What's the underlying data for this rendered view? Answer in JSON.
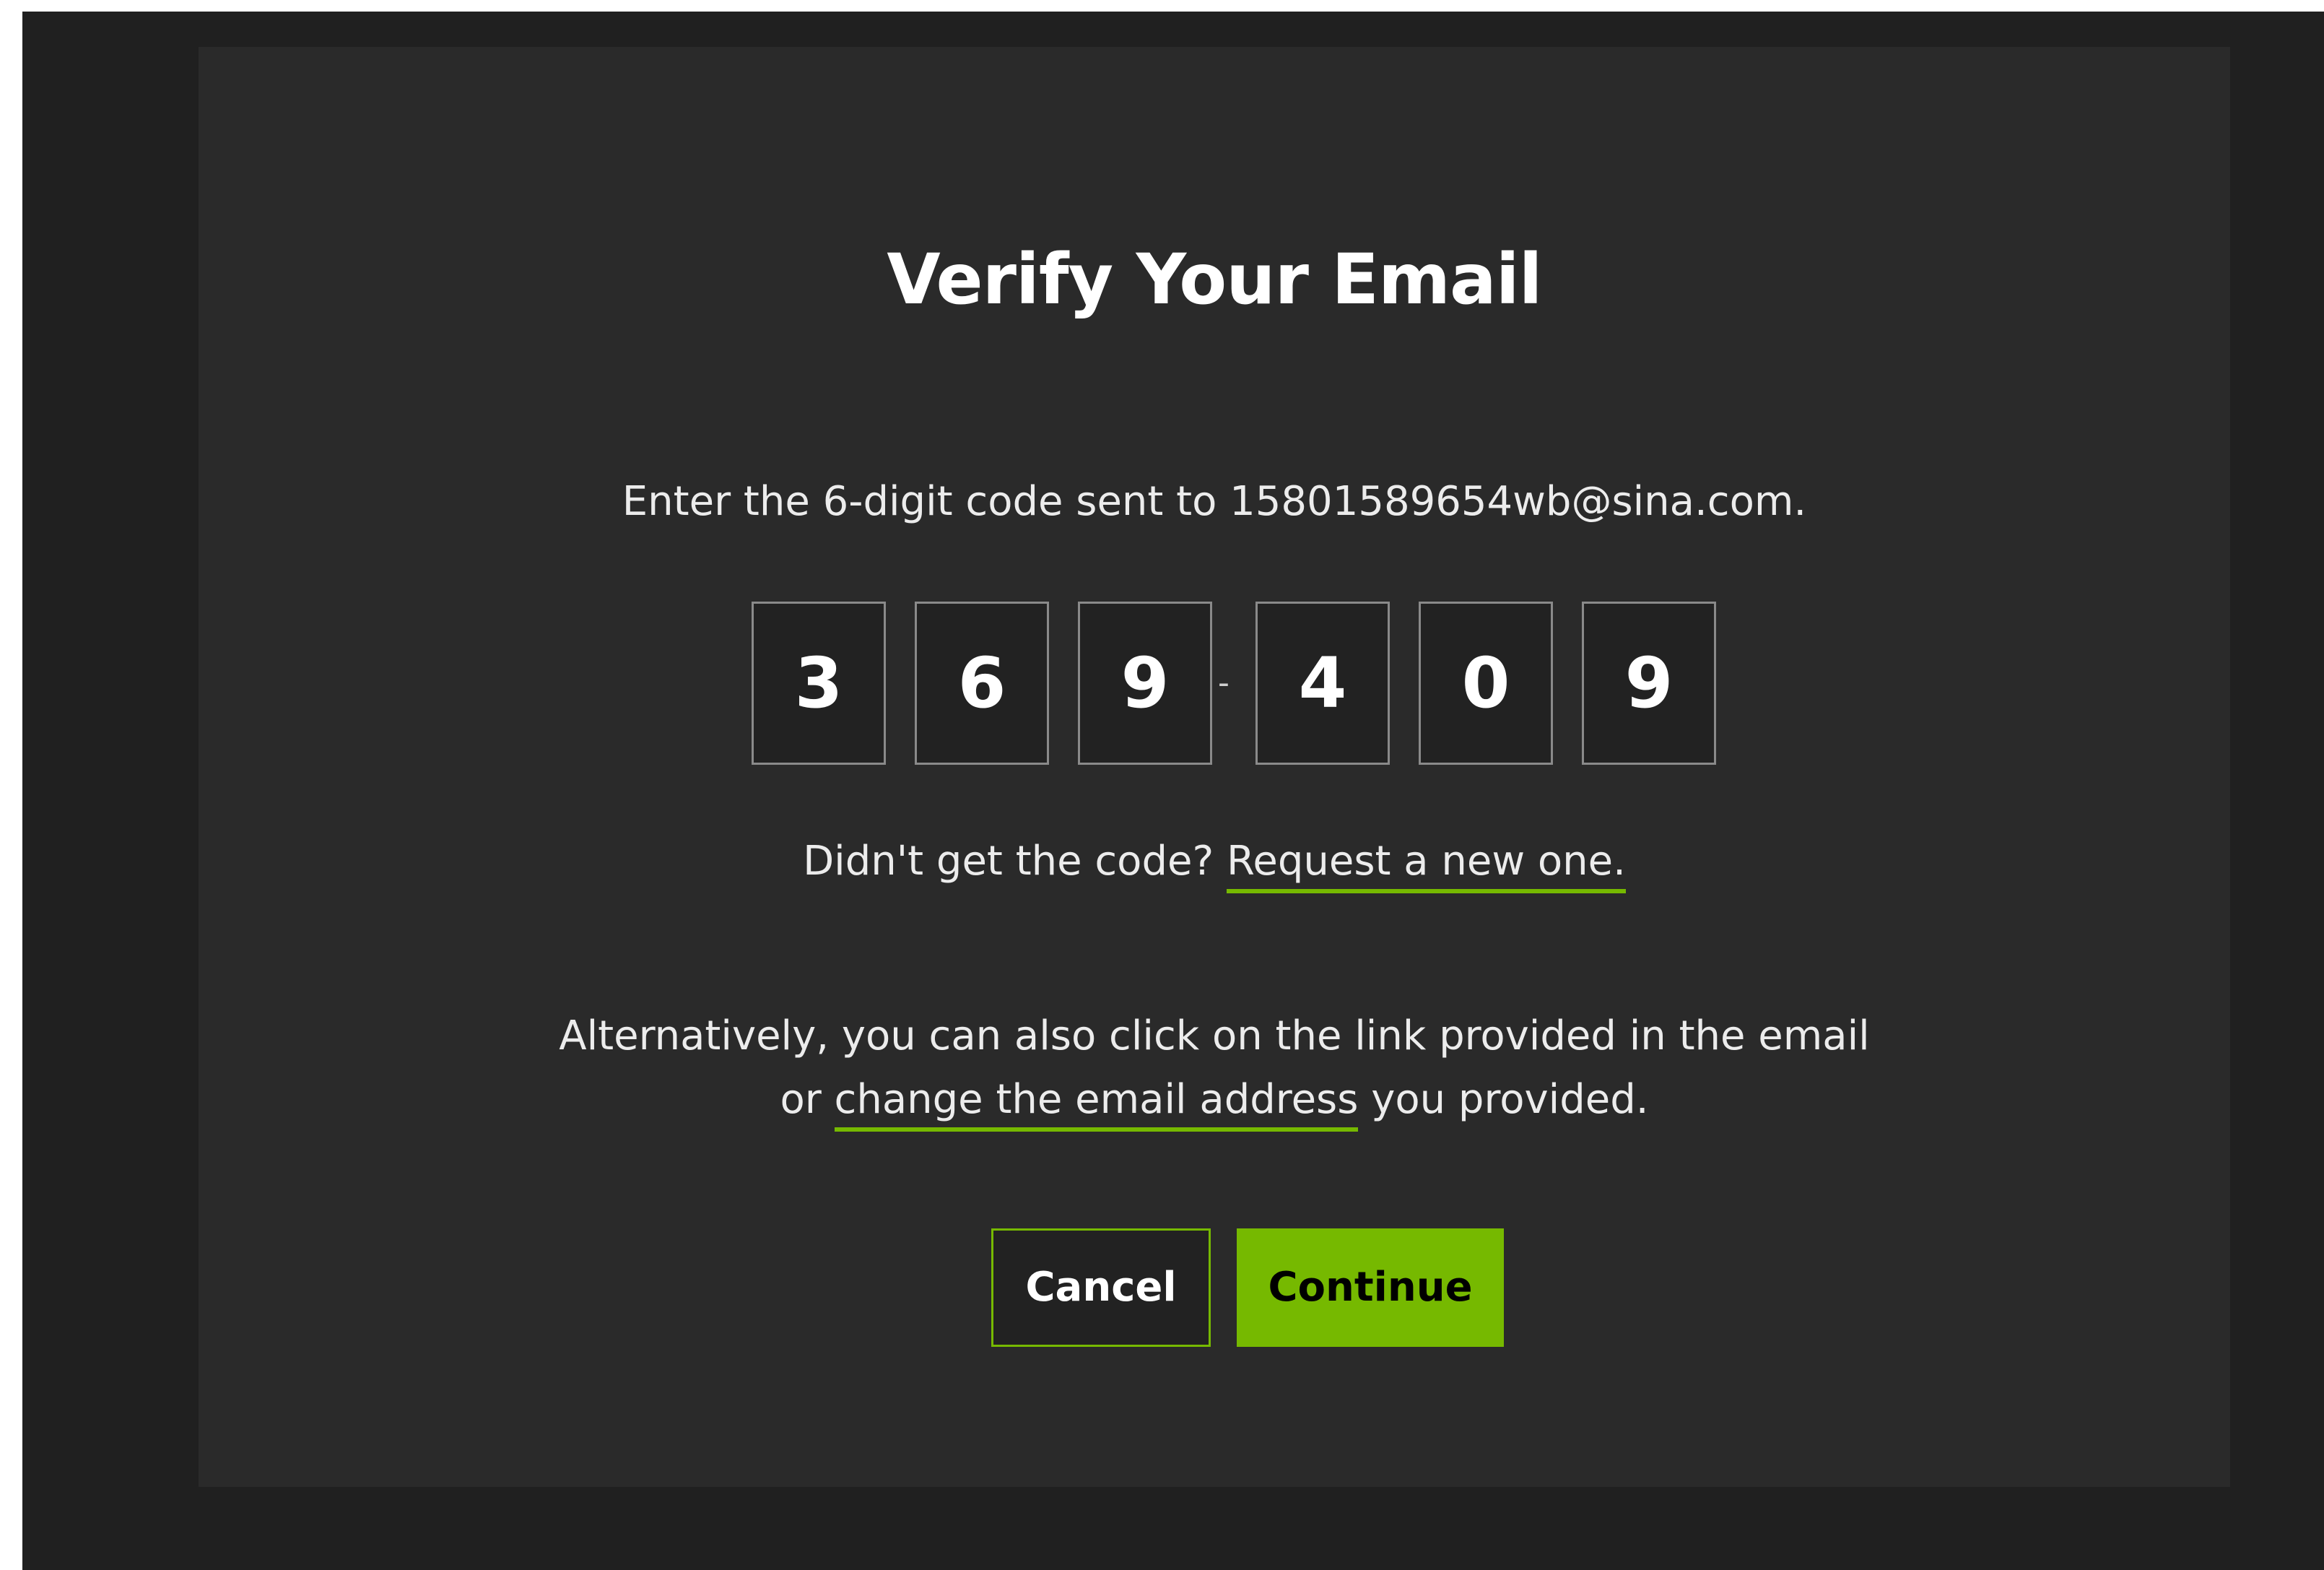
{
  "colors": {
    "accent": "#76b900",
    "background": "#202020",
    "card": "#2a2a2a",
    "text": "#ececec"
  },
  "dialog": {
    "title": "Verify Your Email",
    "instruction_prefix": "Enter the 6-digit code sent to ",
    "email": "15801589654wb@sina.com",
    "instruction_suffix": ".",
    "code_digits": [
      "3",
      "6",
      "9",
      "4",
      "0",
      "9"
    ],
    "code_separator": "-",
    "resend_prompt": "Didn't get the code?",
    "resend_link": "Request a new one.",
    "alt_line1": "Alternatively, you can also click on the link provided in the email",
    "alt_line2_prefix": "or",
    "change_email_link": "change the email address",
    "alt_line2_suffix": "you provided.",
    "cancel_label": "Cancel",
    "continue_label": "Continue"
  }
}
